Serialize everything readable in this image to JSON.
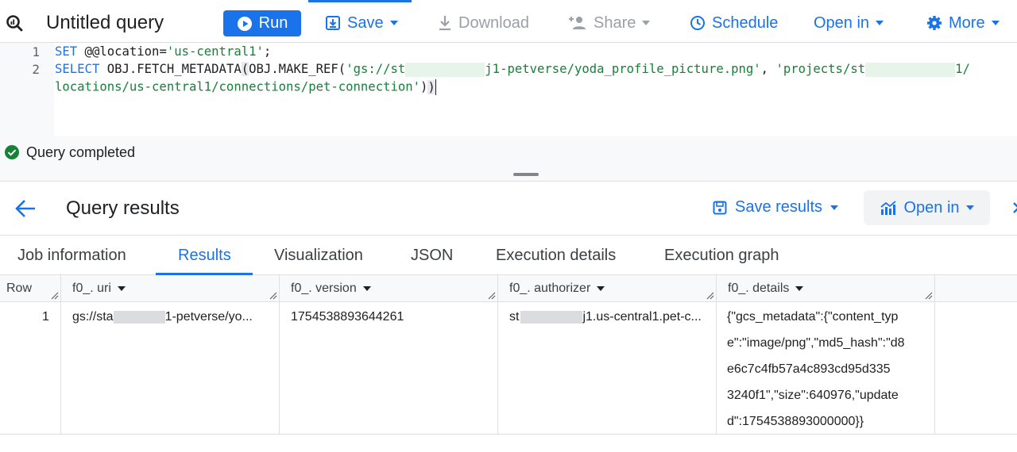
{
  "toolbar": {
    "title": "Untitled query",
    "run": "Run",
    "save": "Save",
    "download": "Download",
    "share": "Share",
    "schedule": "Schedule",
    "open_in": "Open in",
    "more": "More"
  },
  "editor": {
    "line_numbers": [
      "1",
      "2"
    ],
    "line1": {
      "kw": "SET",
      "var": " @@location=",
      "str": "'us-central1'",
      "end": ";"
    },
    "line2": {
      "kw": "SELECT",
      "fn1": " OBJ.FETCH_METADATA",
      "paren1": "(",
      "fn2": "OBJ.MAKE_REF(",
      "str1a": "'gs://st",
      "str1b": "j1-petverse/yoda_profile_picture.png'",
      "comma": ", ",
      "str2a": "'projects/st",
      "str2b": "1/"
    },
    "line3": {
      "str": "locations/us-central1/connections/pet-connection'",
      "close1": ")",
      "close2": ")"
    }
  },
  "status": {
    "text": "Query completed"
  },
  "results": {
    "title": "Query results",
    "save_results": "Save results",
    "open_in": "Open in"
  },
  "tabs": [
    "Job information",
    "Results",
    "Visualization",
    "JSON",
    "Execution details",
    "Execution graph"
  ],
  "table": {
    "headers": [
      "Row",
      "f0_. uri",
      "f0_. version",
      "f0_. authorizer",
      "f0_. details"
    ],
    "row": {
      "num": "1",
      "uri_a": "gs://sta",
      "uri_b": "1-petverse/yo...",
      "version": "1754538893644261",
      "auth_a": "st",
      "auth_b": "j1.us-central1.pet-c...",
      "details_lines": [
        "{\"gcs_metadata\":{\"content_typ",
        "e\":\"image/png\",\"md5_hash\":\"d8",
        "e6c7c4fb57a4c893cd95d335",
        "3240f1\",\"size\":640976,\"update",
        "d\":1754538893000000}}"
      ]
    }
  },
  "colors": {
    "accent": "#1a73e8",
    "success": "#188038"
  }
}
